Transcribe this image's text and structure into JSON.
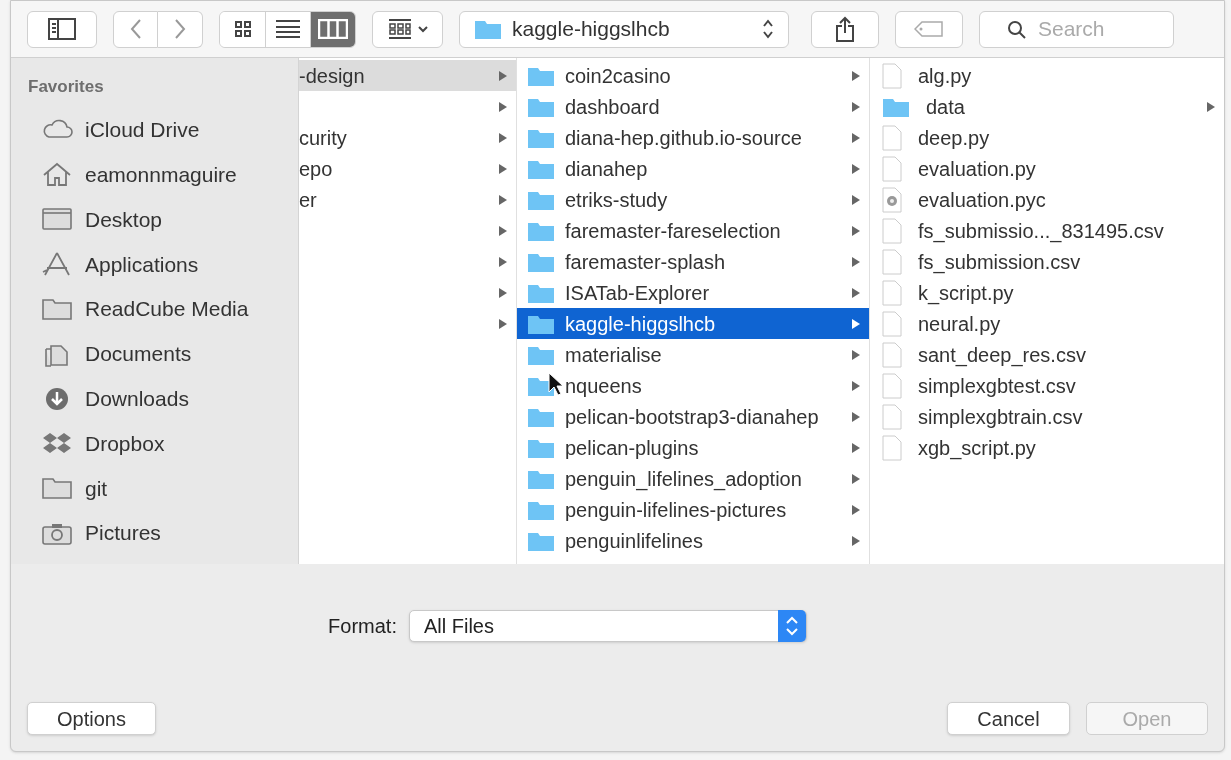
{
  "toolbar": {
    "view_modes": [
      {
        "kind": "icons",
        "selected": false
      },
      {
        "kind": "list",
        "selected": false
      },
      {
        "kind": "columns",
        "selected": true
      }
    ],
    "path": "kaggle-higgslhcb",
    "search": {
      "placeholder": "Search"
    }
  },
  "sidebar": {
    "heading": "Favorites",
    "items": [
      {
        "label": "iCloud Drive",
        "kind": "cloud"
      },
      {
        "label": "eamonnmaguire",
        "kind": "home"
      },
      {
        "label": "Desktop",
        "kind": "desktop"
      },
      {
        "label": "Applications",
        "kind": "apps"
      },
      {
        "label": "ReadCube Media",
        "kind": "folder"
      },
      {
        "label": "Documents",
        "kind": "documents"
      },
      {
        "label": "Downloads",
        "kind": "downloads"
      },
      {
        "label": "Dropbox",
        "kind": "dropbox"
      },
      {
        "label": "git",
        "kind": "folder"
      },
      {
        "label": "Pictures",
        "kind": "camera"
      }
    ]
  },
  "columns": [
    {
      "rows": [
        {
          "label": "-design",
          "selected": true
        },
        {
          "selected": false
        },
        {
          "label": "curity",
          "selected": false
        },
        {
          "label": "epo",
          "selected": false
        },
        {
          "label": "er",
          "selected": false
        },
        {
          "selected": false
        },
        {
          "selected": false
        },
        {
          "selected": false
        },
        {
          "selected": false
        }
      ]
    },
    {
      "rows": [
        {
          "label": "coin2casino",
          "selected": false
        },
        {
          "label": "dashboard",
          "selected": false
        },
        {
          "label": "diana-hep.github.io-source",
          "selected": false
        },
        {
          "label": "dianahep",
          "selected": false
        },
        {
          "label": "etriks-study",
          "selected": false
        },
        {
          "label": "faremaster-fareselection",
          "selected": false
        },
        {
          "label": "faremaster-splash",
          "selected": false
        },
        {
          "label": "ISATab-Explorer",
          "selected": false
        },
        {
          "label": "kaggle-higgslhcb",
          "selected": true
        },
        {
          "label": "materialise",
          "selected": false
        },
        {
          "label": "nqueens",
          "selected": false
        },
        {
          "label": "pelican-bootstrap3-dianahep",
          "selected": false
        },
        {
          "label": "pelican-plugins",
          "selected": false
        },
        {
          "label": "penguin_lifelines_adoption",
          "selected": false
        },
        {
          "label": "penguin-lifelines-pictures",
          "selected": false
        },
        {
          "label": "penguinlifelines",
          "selected": false
        }
      ]
    },
    {
      "rows": [
        {
          "label": "alg.py",
          "kind": "file"
        },
        {
          "label": "data",
          "kind": "folder"
        },
        {
          "label": "deep.py",
          "kind": "file"
        },
        {
          "label": "evaluation.py",
          "kind": "file"
        },
        {
          "label": "evaluation.pyc",
          "kind": "compiled"
        },
        {
          "label": "fs_submissio..._831495.csv",
          "kind": "file"
        },
        {
          "label": "fs_submission.csv",
          "kind": "file"
        },
        {
          "label": "k_script.py",
          "kind": "file"
        },
        {
          "label": "neural.py",
          "kind": "file"
        },
        {
          "label": "sant_deep_res.csv",
          "kind": "file"
        },
        {
          "label": "simplexgbtest.csv",
          "kind": "file"
        },
        {
          "label": "simplexgbtrain.csv",
          "kind": "file"
        },
        {
          "label": "xgb_script.py",
          "kind": "file"
        }
      ]
    }
  ],
  "format": {
    "label": "Format:",
    "value": "All Files"
  },
  "buttons": {
    "options": "Options",
    "cancel": "Cancel",
    "open": {
      "label": "Open",
      "disabled": true
    }
  }
}
